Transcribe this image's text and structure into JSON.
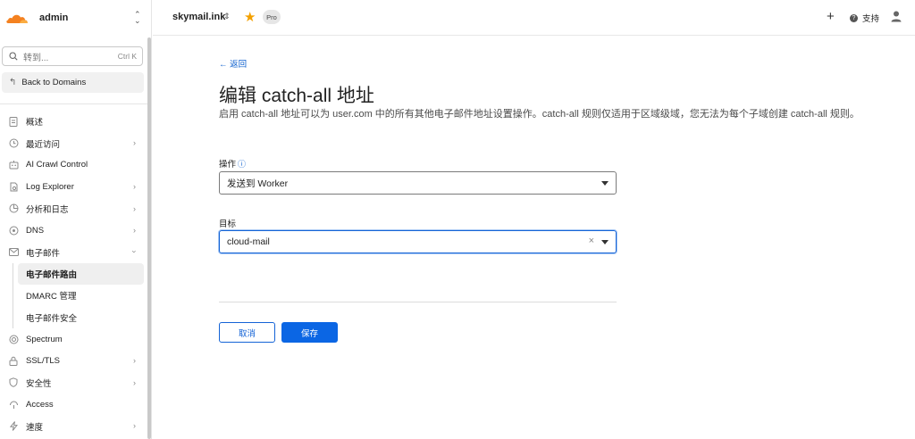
{
  "account": {
    "name": "admin"
  },
  "search": {
    "placeholder": "转到...",
    "shortcut": "Ctrl K"
  },
  "back_to_domains": "Back to Domains",
  "sidebar": {
    "items": [
      {
        "label": "概述",
        "icon": "document-icon",
        "chevron": false
      },
      {
        "label": "最近访问",
        "icon": "clock-icon",
        "chevron": true
      },
      {
        "label": "AI Crawl Control",
        "icon": "robot-icon",
        "chevron": false
      },
      {
        "label": "Log Explorer",
        "icon": "log-file-icon",
        "chevron": true
      },
      {
        "label": "分析和日志",
        "icon": "chart-icon",
        "chevron": true
      },
      {
        "label": "DNS",
        "icon": "dns-icon",
        "chevron": true
      },
      {
        "label": "电子邮件",
        "icon": "mail-icon",
        "chevron": "down"
      }
    ],
    "email_sub": [
      {
        "label": "电子邮件路由",
        "active": true
      },
      {
        "label": "DMARC 管理",
        "active": false
      },
      {
        "label": "电子邮件安全",
        "active": false
      }
    ],
    "items_after": [
      {
        "label": "Spectrum",
        "icon": "spectrum-icon",
        "chevron": false
      },
      {
        "label": "SSL/TLS",
        "icon": "lock-icon",
        "chevron": true
      },
      {
        "label": "安全性",
        "icon": "shield-icon",
        "chevron": true
      },
      {
        "label": "Access",
        "icon": "access-icon",
        "chevron": false
      },
      {
        "label": "速度",
        "icon": "bolt-icon",
        "chevron": true
      }
    ]
  },
  "topbar": {
    "domain": "skymail.ink",
    "plan": "Pro",
    "support": "支持"
  },
  "page": {
    "back": "← 返回",
    "title": "编辑 catch-all 地址",
    "description": "启用 catch-all 地址可以为 user.com 中的所有其他电子邮件地址设置操作。catch-all 规则仅适用于区域级域，您无法为每个子域创建 catch-all 规则。",
    "action_label": "操作",
    "action_value": "发送到 Worker",
    "target_label": "目标",
    "target_value": "cloud-mail",
    "cancel": "取消",
    "save": "保存"
  },
  "colors": {
    "accent": "#0b66e4",
    "star": "#f3a000",
    "logo": "#f48120"
  }
}
